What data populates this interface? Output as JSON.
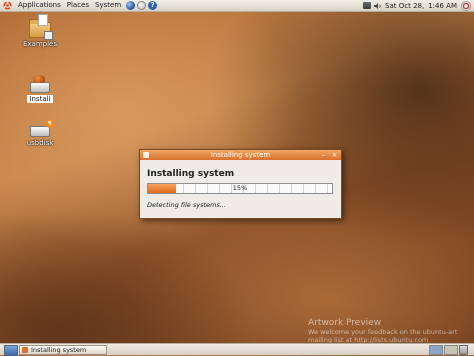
{
  "top_panel": {
    "menus": [
      "Applications",
      "Places",
      "System"
    ],
    "launchers": [
      "web-browser-icon",
      "mail-icon",
      "help-icon"
    ],
    "help_glyph": "?",
    "date": "Sat Oct 28,",
    "time": "1:46 AM"
  },
  "desktop": {
    "icons": [
      {
        "label": "Examples",
        "icon": "folder-icon"
      },
      {
        "label": "Install",
        "icon": "installer-icon",
        "selected": true
      },
      {
        "label": "usbdisk",
        "icon": "usb-drive-icon"
      }
    ]
  },
  "dialog": {
    "title": "Installing system",
    "heading": "Installing system",
    "progress_percent": 15,
    "progress_text": "15%",
    "status": "Detecting file systems...",
    "colors": {
      "accent": "#de6c1f",
      "titlebar": "#d8702b"
    }
  },
  "bottom_panel": {
    "task_label": "Installing system",
    "workspaces": 2,
    "active_workspace": 1
  },
  "watermark": {
    "title": "Artwork Preview",
    "line1": "We welcome your feedback on the ubuntu-art",
    "line2": "mailing list at http://lists.ubuntu.com"
  }
}
